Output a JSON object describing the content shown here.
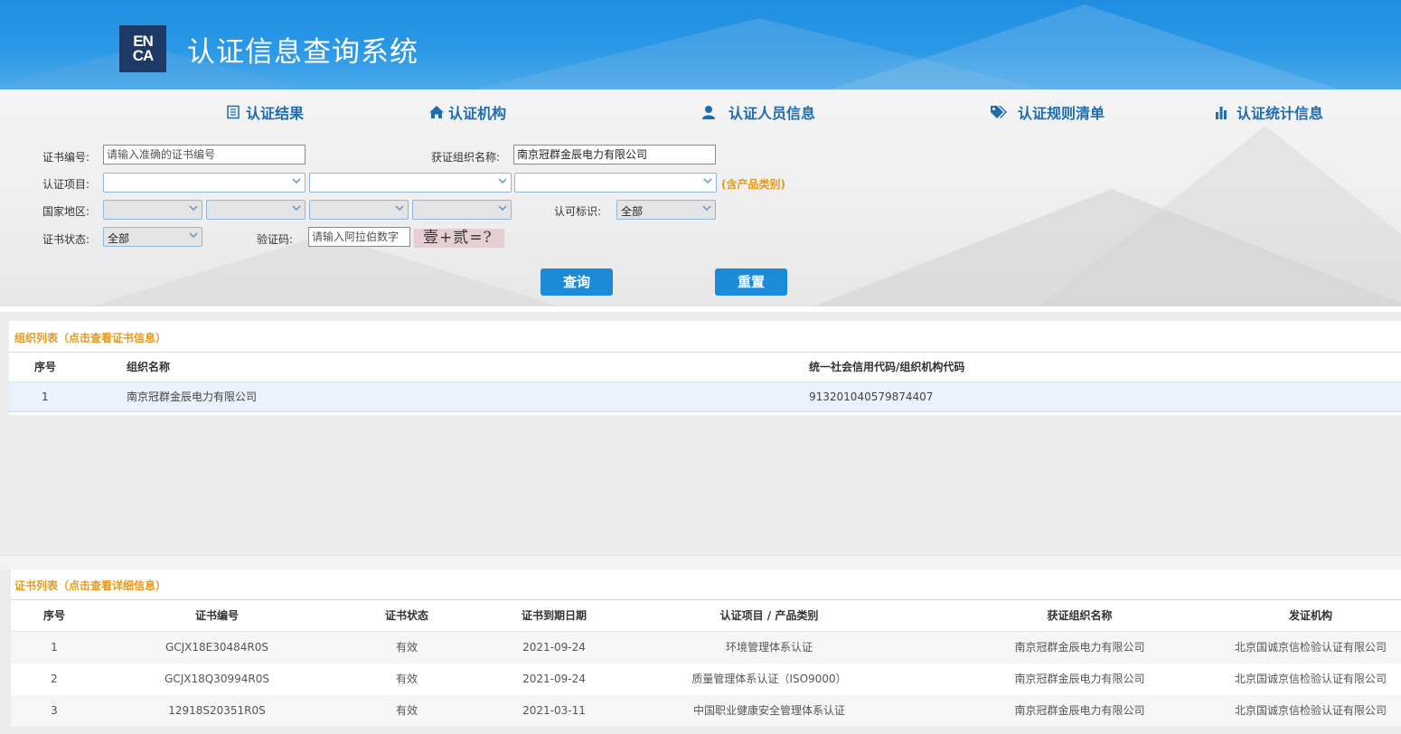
{
  "header": {
    "logo_top": "EN",
    "logo_bottom": "CA",
    "title": "认证信息查询系统"
  },
  "nav": [
    {
      "label": "认证结果",
      "icon": "list-icon"
    },
    {
      "label": "认证机构",
      "icon": "home-icon"
    },
    {
      "label": "认证人员信息",
      "icon": "user-icon"
    },
    {
      "label": "认证规则清单",
      "icon": "tags-icon"
    },
    {
      "label": "认证统计信息",
      "icon": "bar-chart-icon"
    }
  ],
  "search": {
    "cert_no_label": "证书编号:",
    "cert_no_placeholder": "请输入准确的证书编号",
    "org_name_label": "获证组织名称:",
    "org_name_value": "南京冠群金辰电力有限公司",
    "project_label": "认证项目:",
    "product_hint": "(含产品类别)",
    "region_label": "国家地区:",
    "accredit_label": "认可标识:",
    "accredit_value": "全部",
    "status_label": "证书状态:",
    "status_value": "全部",
    "captcha_label": "验证码:",
    "captcha_placeholder": "请输入阿拉伯数字",
    "captcha_text": "壹+贰=?",
    "query_button": "查询",
    "reset_button": "重置"
  },
  "org_list": {
    "title": "组织列表（点击查看证书信息）",
    "headers": [
      "序号",
      "组织名称",
      "统一社会信用代码/组织机构代码"
    ],
    "rows": [
      {
        "no": "1",
        "name": "南京冠群金辰电力有限公司",
        "code": "913201040579874407"
      }
    ]
  },
  "cert_list": {
    "title": "证书列表（点击查看详细信息）",
    "headers": [
      "序号",
      "证书编号",
      "证书状态",
      "证书到期日期",
      "认证项目 / 产品类别",
      "获证组织名称",
      "发证机构"
    ],
    "rows": [
      {
        "no": "1",
        "cert_no": "GCJX18E30484R0S",
        "status": "有效",
        "expiry": "2021-09-24",
        "project": "环境管理体系认证",
        "org": "南京冠群金辰电力有限公司",
        "issuer": "北京国诚京信检验认证有限公司"
      },
      {
        "no": "2",
        "cert_no": "GCJX18Q30994R0S",
        "status": "有效",
        "expiry": "2021-09-24",
        "project": "质量管理体系认证（ISO9000）",
        "org": "南京冠群金辰电力有限公司",
        "issuer": "北京国诚京信检验认证有限公司"
      },
      {
        "no": "3",
        "cert_no": "12918S20351R0S",
        "status": "有效",
        "expiry": "2021-03-11",
        "project": "中国职业健康安全管理体系认证",
        "org": "南京冠群金辰电力有限公司",
        "issuer": "北京国诚京信检验认证有限公司"
      }
    ]
  },
  "colors": {
    "header_blue": "#2a98e6",
    "nav_blue": "#1d6db0",
    "button_blue": "#1c8ad6",
    "accent_orange": "#e69a1e",
    "selected_row": "#eaf2fb"
  }
}
